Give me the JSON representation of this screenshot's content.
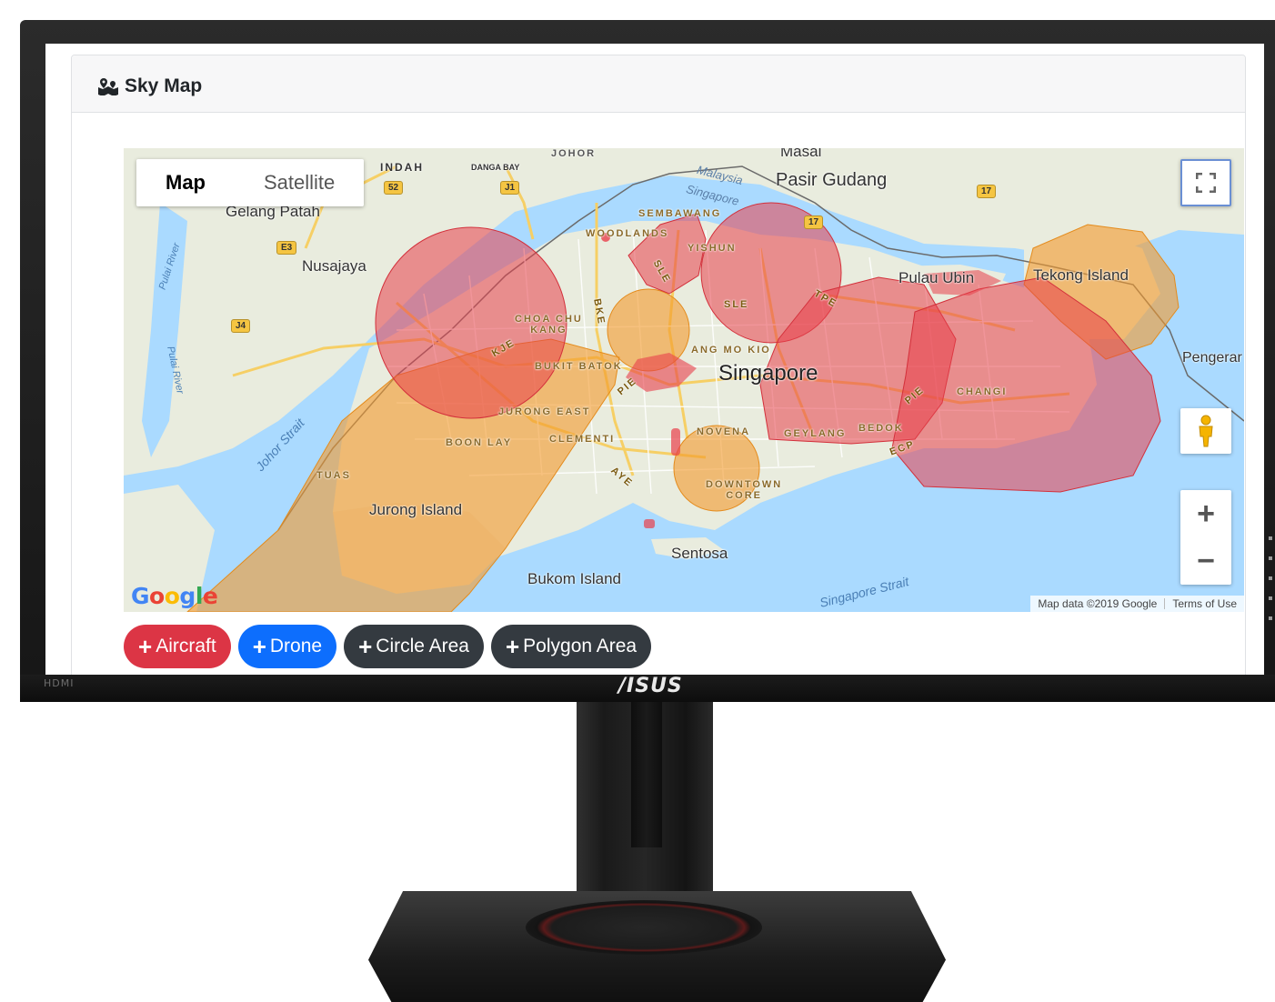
{
  "card": {
    "title": "Sky Map",
    "title_icon": "map-pin-icon"
  },
  "map": {
    "type_controls": {
      "map_label": "Map",
      "satellite_label": "Satellite",
      "selected": "Map"
    },
    "places": {
      "masai": "Masai",
      "pasir_gudang": "Pasir Gudang",
      "gelang_patah": "Gelang Patah",
      "nusajaya": "Nusajaya",
      "pulau_ubin": "Pulau Ubin",
      "tekong_island": "Tekong Island",
      "singapore": "Singapore",
      "pengerang": "Pengerar",
      "jurong_island": "Jurong Island",
      "sentosa": "Sentosa",
      "bukom_island": "Bukom Island",
      "indah": "INDAH",
      "danga_bay": "DANGA BAY",
      "johor": "JOHOR",
      "malaysia": "Malaysia",
      "singapore_border": "Singapore",
      "sembawang": "SEMBAWANG",
      "woodlands": "WOODLANDS",
      "yishun": "YISHUN",
      "choa_chu_kang": "CHOA CHU\nKANG",
      "bukit_batok": "BUKIT BATOK",
      "jurong_east": "JURONG EAST",
      "boon_lay": "BOON LAY",
      "clementi": "CLEMENTI",
      "tuas": "TUAS",
      "ang_mo_kio": "ANG MO KIO",
      "novena": "NOVENA",
      "geylang": "GEYLANG",
      "bedok": "BEDOK",
      "changi": "CHANGI",
      "downtown_core": "DOWNTOWN\nCORE"
    },
    "water": {
      "johor_strait": "Johor Strait",
      "singapore_strait": "Singapore Strait",
      "pulai_river_1": "Pulai River",
      "pulai_river_2": "Pulai River"
    },
    "roads": {
      "j1": "J1",
      "r52": "52",
      "e3": "E3",
      "j4": "J4",
      "r17a": "17",
      "r17b": "17",
      "sle": "SLE",
      "sle2": "SLE",
      "bke": "BKE",
      "kje": "KJE",
      "pie": "PIE",
      "pie2": "PIE",
      "tpe": "TPE",
      "ecp": "ECP",
      "aye": "AYE"
    },
    "attribution": {
      "data": "Map data ©2019 Google",
      "terms": "Terms of Use"
    },
    "google_logo": "Google",
    "zoom": {
      "in": "+",
      "out": "−"
    }
  },
  "actions": [
    {
      "label": "Aircraft",
      "color": "#dc3545"
    },
    {
      "label": "Drone",
      "color": "#0d6efd"
    },
    {
      "label": "Circle Area",
      "color": "#343a40"
    },
    {
      "label": "Polygon Area",
      "color": "#343a40"
    }
  ],
  "monitor": {
    "brand": "/ISUS",
    "port_label": "HDMI"
  },
  "colors": {
    "restricted_zone": "#e8404b",
    "caution_zone": "#f39a2c",
    "water": "#aadaff",
    "land": "#e9ecde"
  }
}
